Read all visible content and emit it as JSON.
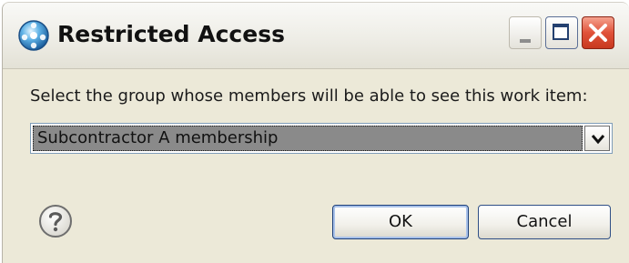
{
  "window": {
    "title": "Restricted Access"
  },
  "dialog": {
    "instruction": "Select the group whose members will be able to see this work item:",
    "group_select": {
      "selected": "Subcontractor A membership"
    },
    "buttons": {
      "ok_label": "OK",
      "cancel_label": "Cancel"
    }
  },
  "icons": {
    "title": "app-globe-icon",
    "help": "help-icon",
    "minimize": "minimize-icon",
    "maximize": "maximize-icon",
    "close": "close-icon",
    "dropdown": "chevron-down-icon"
  },
  "colors": {
    "dialog_background": "#ece9d8",
    "selection_highlight": "#8a8a8a",
    "close_button": "#e0523a",
    "default_button_border": "#1c3f7a"
  }
}
